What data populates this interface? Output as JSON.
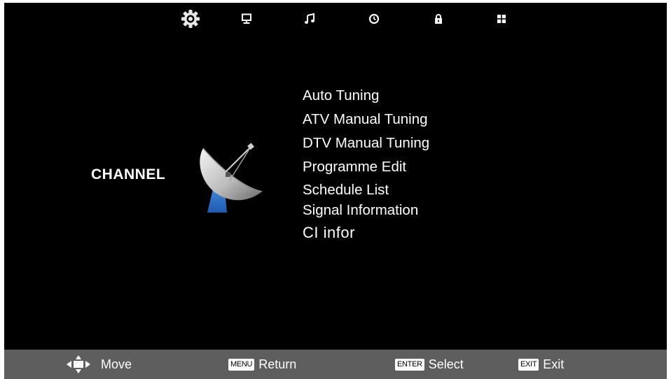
{
  "top_tabs": [
    {
      "icon": "gear-icon",
      "selected": true
    },
    {
      "icon": "monitor-icon",
      "selected": false
    },
    {
      "icon": "music-note-icon",
      "selected": false
    },
    {
      "icon": "clock-icon",
      "selected": false
    },
    {
      "icon": "lock-icon",
      "selected": false
    },
    {
      "icon": "apps-grid-icon",
      "selected": false
    }
  ],
  "section": {
    "title": "CHANNEL",
    "icon": "satellite-dish-icon"
  },
  "menu": {
    "items": [
      "Auto Tuning",
      "ATV Manual Tuning",
      "DTV Manual Tuning",
      "Programme Edit",
      "Schedule List",
      "Signal Information",
      "CI infor"
    ]
  },
  "footer": {
    "move": {
      "icon": "dpad-icon",
      "label": "Move"
    },
    "return": {
      "key": "MENU",
      "label": "Return"
    },
    "select": {
      "key": "ENTER",
      "label": "Select"
    },
    "exit": {
      "key": "EXIT",
      "label": "Exit"
    }
  },
  "colors": {
    "background": "#000000",
    "text": "#ffffff",
    "footer": "#5f5e5e"
  }
}
